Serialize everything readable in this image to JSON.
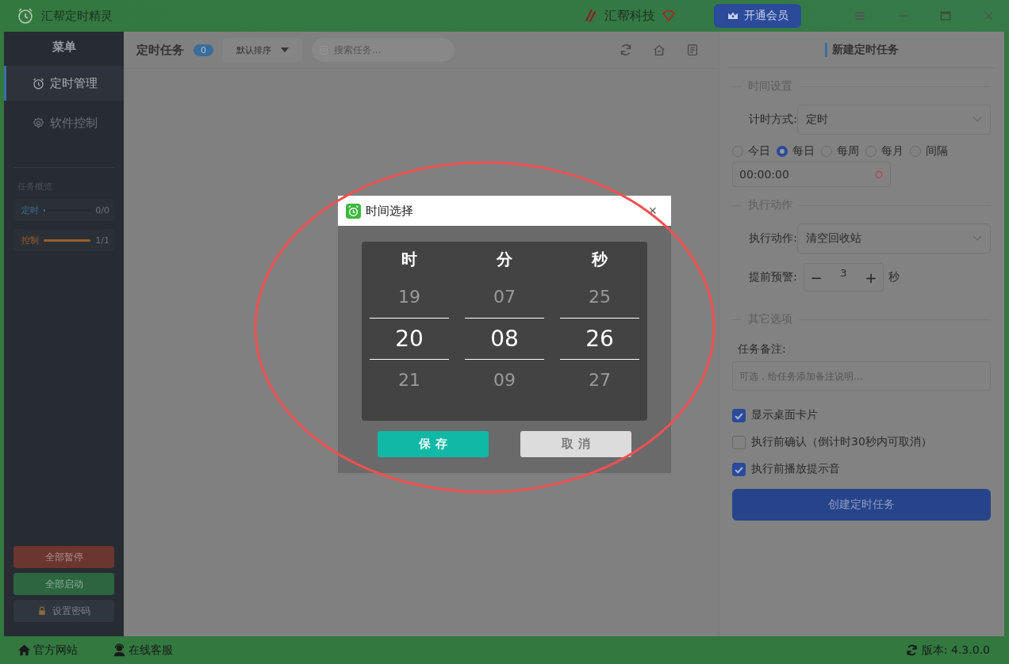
{
  "window": {
    "title": "汇帮定时精灵"
  },
  "header": {
    "brand": "汇帮科技",
    "vip_button": "开通会员"
  },
  "sidebar": {
    "title": "菜单",
    "items": [
      {
        "label": "定时管理",
        "selected": true
      },
      {
        "label": "软件控制",
        "selected": false
      }
    ],
    "overview": {
      "title": "任务概览",
      "rows": [
        {
          "label": "定时",
          "value": "0/0",
          "level": 0,
          "color": "#3b6e98"
        },
        {
          "label": "控制",
          "value": "1/1",
          "level": 1,
          "color": "#9a5e2a"
        }
      ]
    },
    "buttons": [
      {
        "label": "全部暂停",
        "kind": "danger"
      },
      {
        "label": "全部启动",
        "kind": "success"
      },
      {
        "label": "设置密码",
        "kind": "lock"
      }
    ]
  },
  "task_list": {
    "title": "定时任务",
    "count": "0",
    "sort": "默认排序",
    "search": {
      "placeholder": "搜索任务..."
    }
  },
  "new_task": {
    "title": "新建定时任务",
    "time_section": "时间设置",
    "timing_mode": {
      "label": "计时方式:",
      "value": "定时"
    },
    "frequency": [
      {
        "label": "今日",
        "selected": false
      },
      {
        "label": "每日",
        "selected": true
      },
      {
        "label": "每周",
        "selected": false
      },
      {
        "label": "每月",
        "selected": false
      },
      {
        "label": "间隔",
        "selected": false
      }
    ],
    "time_value": "00:00:00",
    "action_section": "执行动作",
    "action": {
      "label": "执行动作:",
      "value": "清空回收站"
    },
    "warning": {
      "label": "提前预警:",
      "value": "3",
      "minus": "−",
      "plus": "+",
      "unit": "秒"
    },
    "other_section": "其它选项",
    "note": {
      "label": "任务备注:",
      "placeholder": "可选，给任务添加备注说明..."
    },
    "options": [
      {
        "label": "显示桌面卡片",
        "checked": true
      },
      {
        "label": "执行前确认（倒计时30秒内可取消）",
        "checked": false
      },
      {
        "label": "执行前播放提示音",
        "checked": true
      }
    ],
    "submit": "创建定时任务"
  },
  "dialog": {
    "title": "时间选择",
    "close": "×",
    "columns": [
      {
        "header": "时",
        "above": "19",
        "current": "20",
        "below": "21"
      },
      {
        "header": "分",
        "above": "07",
        "current": "08",
        "below": "09"
      },
      {
        "header": "秒",
        "above": "25",
        "current": "26",
        "below": "27"
      }
    ],
    "save": "保 存",
    "cancel": "取 消"
  },
  "footer": {
    "links": [
      "官方网站",
      "在线客服"
    ],
    "version": "版本: 4.3.0.0"
  }
}
